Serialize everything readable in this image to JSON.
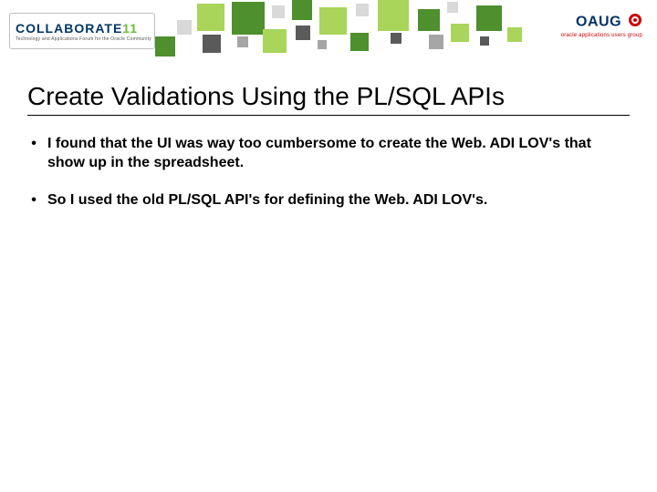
{
  "header": {
    "collaborate_brand": "COLLABORATE",
    "collaborate_year": "11",
    "collaborate_tagline": "Technology and Applications Forum for the Oracle Community",
    "oaug_brand": "OAUG",
    "oaug_tagline": "oracle applications users group"
  },
  "slide": {
    "title": "Create Validations Using the PL/SQL APIs",
    "bullets": [
      "I found that the UI was way too cumbersome to create the Web. ADI LOV's that show up in the spreadsheet.",
      "So I used the old PL/SQL API's for defining the Web. ADI LOV's."
    ]
  }
}
